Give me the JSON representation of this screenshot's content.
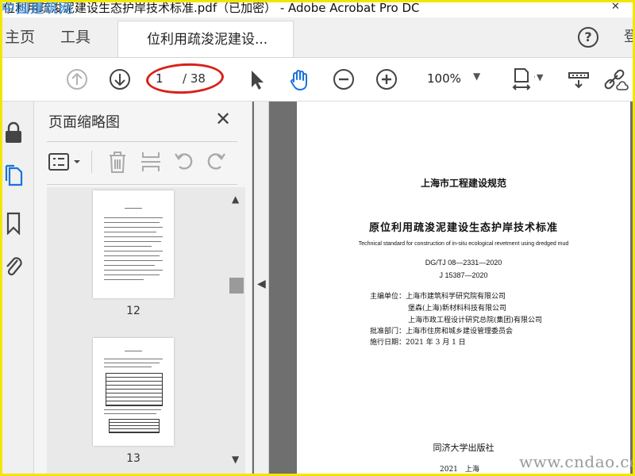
{
  "titlebar": {
    "title": "位利用疏浚泥建设生态护岸技术标准.pdf（已加密） - Adobe Acrobat Pro DC",
    "watermark": "中国建筑网"
  },
  "menubar": {
    "home": "主页",
    "tools": "工具",
    "doc_tab": "位利用疏浚泥建设...",
    "help": "?",
    "side_char": "登"
  },
  "toolbar": {
    "current_page": "1",
    "total_pages": "/ 38",
    "zoom": "100%"
  },
  "thumbnails": {
    "title": "页面缩略图",
    "pages": [
      {
        "label": "12"
      },
      {
        "label": "13"
      }
    ]
  },
  "document": {
    "header": "上海市工程建设规范",
    "title_cn": "原位利用疏浚泥建设生态护岸技术标准",
    "title_en": "Technical standard for construction of in-situ ecological revetment using dredged mud",
    "code1": "DG/TJ 08—2331—2020",
    "code2": "J 15387—2020",
    "editor_label": "主编单位：上海市建筑科学研究院有限公司",
    "editor2": "堡森(上海)新材料科技有限公司",
    "editor3": "上海市政工程设计研究总院(集团)有限公司",
    "approver": "批准部门：上海市住房和城乡建设管理委员会",
    "date": "施行日期：2021 年 3 月 1 日",
    "publisher": "同济大学出版社",
    "year_place": "2021　上海"
  },
  "overlay": {
    "site": "www.cndao.com"
  },
  "colors": {
    "accent_blue": "#1a73d9",
    "highlight_red": "#d9201a",
    "frame_yellow": "#f2e600"
  }
}
